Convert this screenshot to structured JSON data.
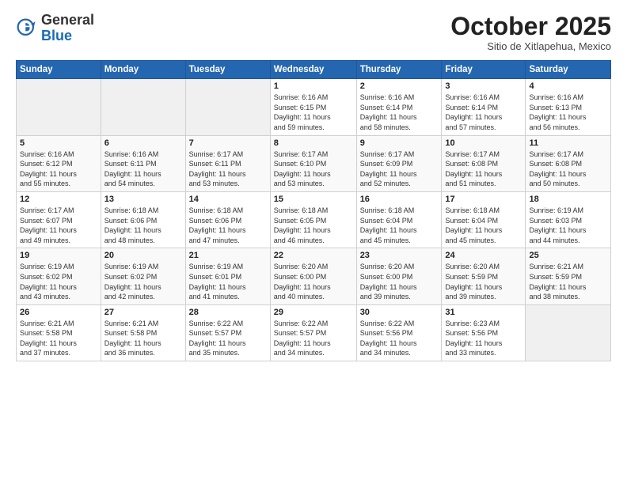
{
  "header": {
    "logo_general": "General",
    "logo_blue": "Blue",
    "month_title": "October 2025",
    "location": "Sitio de Xitlapehua, Mexico"
  },
  "weekdays": [
    "Sunday",
    "Monday",
    "Tuesday",
    "Wednesday",
    "Thursday",
    "Friday",
    "Saturday"
  ],
  "weeks": [
    [
      {
        "day": "",
        "info": ""
      },
      {
        "day": "",
        "info": ""
      },
      {
        "day": "",
        "info": ""
      },
      {
        "day": "1",
        "info": "Sunrise: 6:16 AM\nSunset: 6:15 PM\nDaylight: 11 hours\nand 59 minutes."
      },
      {
        "day": "2",
        "info": "Sunrise: 6:16 AM\nSunset: 6:14 PM\nDaylight: 11 hours\nand 58 minutes."
      },
      {
        "day": "3",
        "info": "Sunrise: 6:16 AM\nSunset: 6:14 PM\nDaylight: 11 hours\nand 57 minutes."
      },
      {
        "day": "4",
        "info": "Sunrise: 6:16 AM\nSunset: 6:13 PM\nDaylight: 11 hours\nand 56 minutes."
      }
    ],
    [
      {
        "day": "5",
        "info": "Sunrise: 6:16 AM\nSunset: 6:12 PM\nDaylight: 11 hours\nand 55 minutes."
      },
      {
        "day": "6",
        "info": "Sunrise: 6:16 AM\nSunset: 6:11 PM\nDaylight: 11 hours\nand 54 minutes."
      },
      {
        "day": "7",
        "info": "Sunrise: 6:17 AM\nSunset: 6:11 PM\nDaylight: 11 hours\nand 53 minutes."
      },
      {
        "day": "8",
        "info": "Sunrise: 6:17 AM\nSunset: 6:10 PM\nDaylight: 11 hours\nand 53 minutes."
      },
      {
        "day": "9",
        "info": "Sunrise: 6:17 AM\nSunset: 6:09 PM\nDaylight: 11 hours\nand 52 minutes."
      },
      {
        "day": "10",
        "info": "Sunrise: 6:17 AM\nSunset: 6:08 PM\nDaylight: 11 hours\nand 51 minutes."
      },
      {
        "day": "11",
        "info": "Sunrise: 6:17 AM\nSunset: 6:08 PM\nDaylight: 11 hours\nand 50 minutes."
      }
    ],
    [
      {
        "day": "12",
        "info": "Sunrise: 6:17 AM\nSunset: 6:07 PM\nDaylight: 11 hours\nand 49 minutes."
      },
      {
        "day": "13",
        "info": "Sunrise: 6:18 AM\nSunset: 6:06 PM\nDaylight: 11 hours\nand 48 minutes."
      },
      {
        "day": "14",
        "info": "Sunrise: 6:18 AM\nSunset: 6:06 PM\nDaylight: 11 hours\nand 47 minutes."
      },
      {
        "day": "15",
        "info": "Sunrise: 6:18 AM\nSunset: 6:05 PM\nDaylight: 11 hours\nand 46 minutes."
      },
      {
        "day": "16",
        "info": "Sunrise: 6:18 AM\nSunset: 6:04 PM\nDaylight: 11 hours\nand 45 minutes."
      },
      {
        "day": "17",
        "info": "Sunrise: 6:18 AM\nSunset: 6:04 PM\nDaylight: 11 hours\nand 45 minutes."
      },
      {
        "day": "18",
        "info": "Sunrise: 6:19 AM\nSunset: 6:03 PM\nDaylight: 11 hours\nand 44 minutes."
      }
    ],
    [
      {
        "day": "19",
        "info": "Sunrise: 6:19 AM\nSunset: 6:02 PM\nDaylight: 11 hours\nand 43 minutes."
      },
      {
        "day": "20",
        "info": "Sunrise: 6:19 AM\nSunset: 6:02 PM\nDaylight: 11 hours\nand 42 minutes."
      },
      {
        "day": "21",
        "info": "Sunrise: 6:19 AM\nSunset: 6:01 PM\nDaylight: 11 hours\nand 41 minutes."
      },
      {
        "day": "22",
        "info": "Sunrise: 6:20 AM\nSunset: 6:00 PM\nDaylight: 11 hours\nand 40 minutes."
      },
      {
        "day": "23",
        "info": "Sunrise: 6:20 AM\nSunset: 6:00 PM\nDaylight: 11 hours\nand 39 minutes."
      },
      {
        "day": "24",
        "info": "Sunrise: 6:20 AM\nSunset: 5:59 PM\nDaylight: 11 hours\nand 39 minutes."
      },
      {
        "day": "25",
        "info": "Sunrise: 6:21 AM\nSunset: 5:59 PM\nDaylight: 11 hours\nand 38 minutes."
      }
    ],
    [
      {
        "day": "26",
        "info": "Sunrise: 6:21 AM\nSunset: 5:58 PM\nDaylight: 11 hours\nand 37 minutes."
      },
      {
        "day": "27",
        "info": "Sunrise: 6:21 AM\nSunset: 5:58 PM\nDaylight: 11 hours\nand 36 minutes."
      },
      {
        "day": "28",
        "info": "Sunrise: 6:22 AM\nSunset: 5:57 PM\nDaylight: 11 hours\nand 35 minutes."
      },
      {
        "day": "29",
        "info": "Sunrise: 6:22 AM\nSunset: 5:57 PM\nDaylight: 11 hours\nand 34 minutes."
      },
      {
        "day": "30",
        "info": "Sunrise: 6:22 AM\nSunset: 5:56 PM\nDaylight: 11 hours\nand 34 minutes."
      },
      {
        "day": "31",
        "info": "Sunrise: 6:23 AM\nSunset: 5:56 PM\nDaylight: 11 hours\nand 33 minutes."
      },
      {
        "day": "",
        "info": ""
      }
    ]
  ]
}
